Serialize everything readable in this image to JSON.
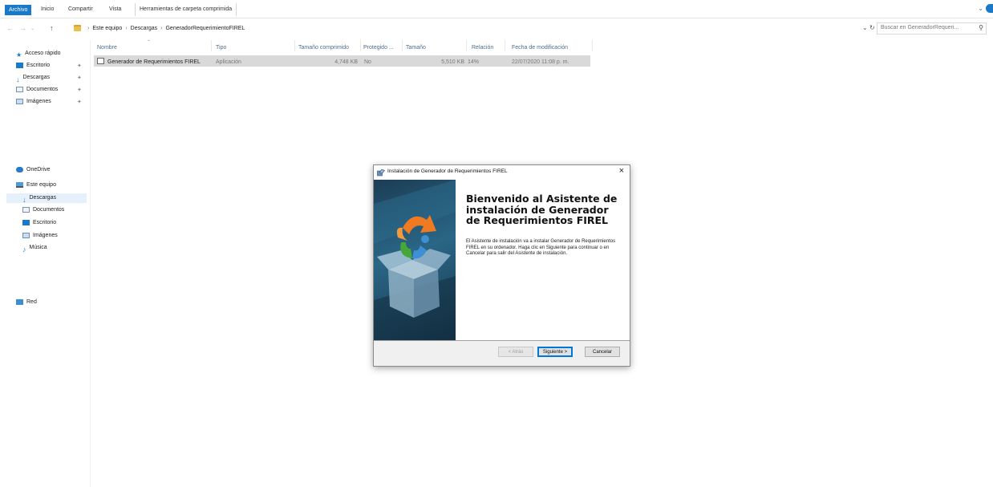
{
  "ribbon": {
    "tabs": [
      "Archivo",
      "Inicio",
      "Compartir",
      "Vista"
    ],
    "context_tab": "Herramientas de carpeta comprimida"
  },
  "address": {
    "crumbs": [
      "Este equipo",
      "Descargas",
      "GeneradorRequerimientoFIREL"
    ],
    "search_placeholder": "Buscar en GeneradorRequeri..."
  },
  "sidebar": {
    "quick_access": "Acceso rápido",
    "quick_items": [
      "Escritorio",
      "Descargas",
      "Documentos",
      "Imágenes"
    ],
    "onedrive": "OneDrive",
    "this_pc": "Este equipo",
    "pc_items": [
      "Descargas",
      "Documentos",
      "Escritorio",
      "Imágenes",
      "Música"
    ],
    "network": "Red"
  },
  "columns": [
    "Nombre",
    "Tipo",
    "Tamaño comprimido",
    "Protegido ...",
    "Tamaño",
    "Relación",
    "Fecha de modificación"
  ],
  "files": [
    {
      "name": "Generador de Requerimientos FIREL",
      "type": "Aplicación",
      "compressed_size": "4,748 KB",
      "protected": "No",
      "size": "5,510 KB",
      "ratio": "14%",
      "modified": "22/07/2020 11:08 p. m."
    }
  ],
  "dialog": {
    "title": "Instalación de Generador de Requerimientos FIREL",
    "heading": "Bienvenido al Asistente de instalación de Generador de Requerimientos FIREL",
    "paragraph": "El Asistente de instalación va a instalar Generador de Requerimientos FIREL en su ordenador. Haga clic en Siguiente para continuar o en Cancelar para salir del Asistente de instalación.",
    "back_label": "< Atrás",
    "next_label": "Siguiente >",
    "cancel_label": "Cancelar"
  },
  "colors": {
    "accent": "#1979ca",
    "selection": "#d9d9d9",
    "header_text": "#4d6d8c"
  }
}
